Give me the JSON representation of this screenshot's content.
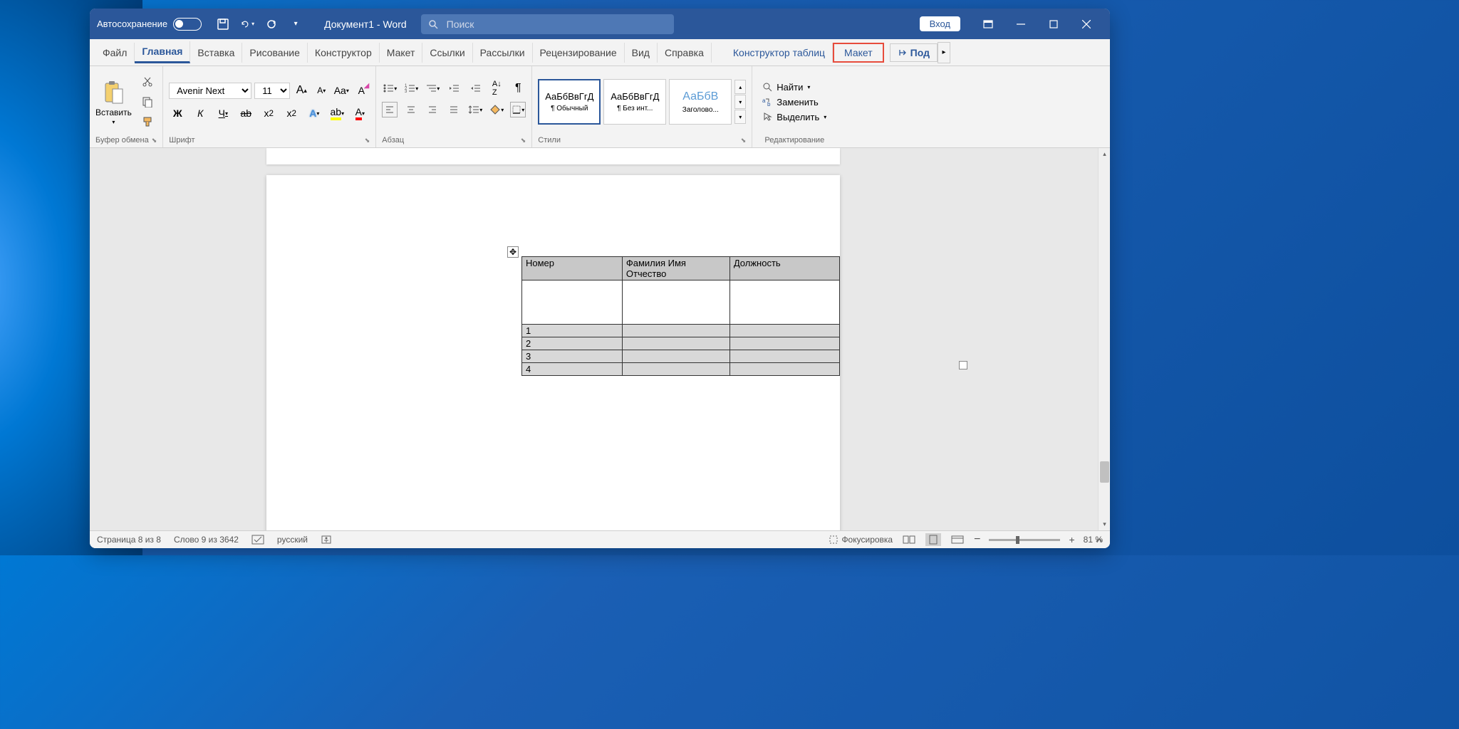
{
  "titlebar": {
    "autosave_label": "Автосохранение",
    "doc_title": "Документ1  -  Word",
    "search_placeholder": "Поиск",
    "login_label": "Вход"
  },
  "tabs": {
    "file": "Файл",
    "home": "Главная",
    "insert": "Вставка",
    "draw": "Рисование",
    "design": "Конструктор",
    "layout": "Макет",
    "references": "Ссылки",
    "mailings": "Рассылки",
    "review": "Рецензирование",
    "view": "Вид",
    "help": "Справка",
    "table_design": "Конструктор таблиц",
    "table_layout": "Макет",
    "share": "Под"
  },
  "ribbon": {
    "clipboard": {
      "label": "Буфер обмена",
      "paste": "Вставить"
    },
    "font": {
      "label": "Шрифт",
      "name": "Avenir Next",
      "size": "11",
      "bold": "Ж",
      "italic": "К",
      "underline": "Ч",
      "strike": "ab",
      "sub": "x₂",
      "sup": "x²"
    },
    "paragraph": {
      "label": "Абзац"
    },
    "styles": {
      "label": "Стили",
      "item1_preview": "АаБбВвГгД",
      "item1_name": "¶ Обычный",
      "item2_preview": "АаБбВвГгД",
      "item2_name": "¶ Без инт...",
      "item3_preview": "АаБбВ",
      "item3_name": "Заголово..."
    },
    "editing": {
      "label": "Редактирование",
      "find": "Найти",
      "replace": "Заменить",
      "select": "Выделить"
    }
  },
  "table": {
    "h1": "Номер",
    "h2": "Фамилия Имя Отчество",
    "h3": "Должность",
    "r1": "1",
    "r2": "2",
    "r3": "3",
    "r4": "4"
  },
  "statusbar": {
    "page": "Страница 8 из 8",
    "words": "Слово 9 из 3642",
    "lang": "русский",
    "focus": "Фокусировка",
    "zoom": "81 %"
  }
}
